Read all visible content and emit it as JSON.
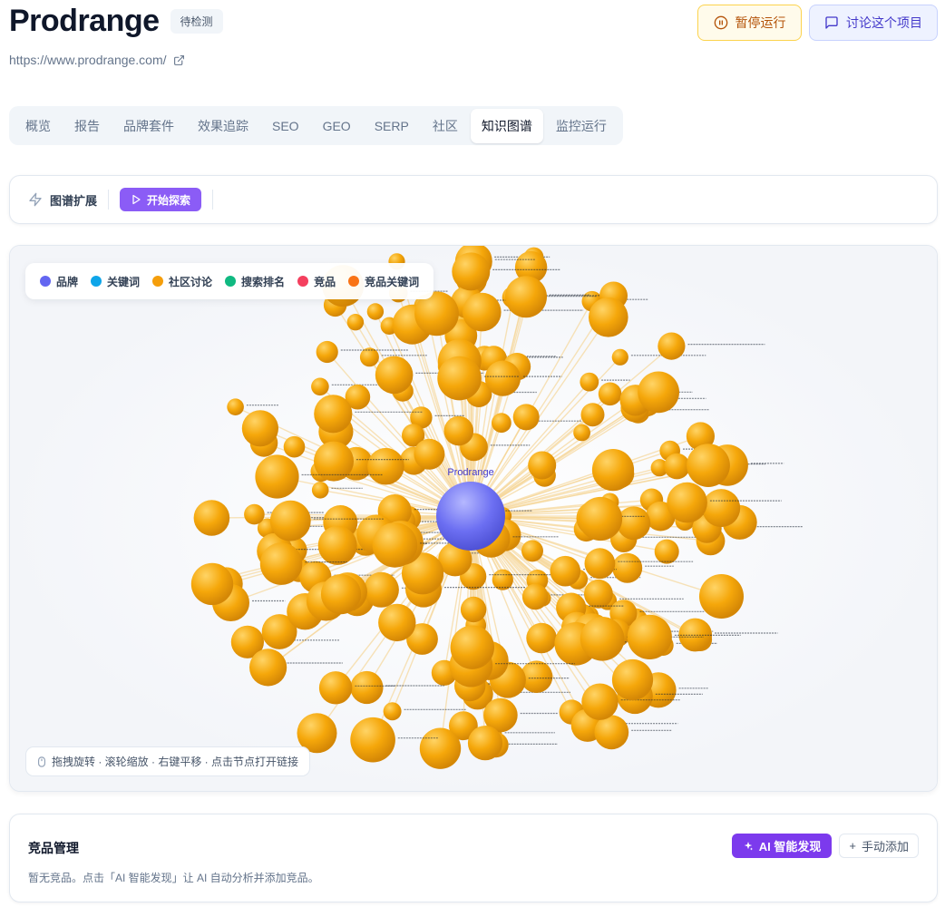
{
  "header": {
    "title": "Prodrange",
    "status": "待检测",
    "url": "https://www.prodrange.com/",
    "pause_label": "暂停运行",
    "discuss_label": "讨论这个项目"
  },
  "tabs": [
    {
      "label": "概览",
      "active": false
    },
    {
      "label": "报告",
      "active": false
    },
    {
      "label": "品牌套件",
      "active": false
    },
    {
      "label": "效果追踪",
      "active": false
    },
    {
      "label": "SEO",
      "active": false
    },
    {
      "label": "GEO",
      "active": false
    },
    {
      "label": "SERP",
      "active": false
    },
    {
      "label": "社区",
      "active": false
    },
    {
      "label": "知识图谱",
      "active": true
    },
    {
      "label": "监控运行",
      "active": false
    }
  ],
  "expand": {
    "label": "图谱扩展",
    "explore_label": "开始探索"
  },
  "graph": {
    "legend": [
      {
        "label": "品牌",
        "color": "#6366f1"
      },
      {
        "label": "关键词",
        "color": "#0ea5e9"
      },
      {
        "label": "社区讨论",
        "color": "#f59e0b"
      },
      {
        "label": "搜索排名",
        "color": "#10b981"
      },
      {
        "label": "竞品",
        "color": "#f43f5e"
      },
      {
        "label": "竞品关键词",
        "color": "#f97316"
      }
    ],
    "center_label": "Prodrange",
    "node_color": "#f59e0b",
    "center_color": "#6366f1",
    "hint": "拖拽旋转 · 滚轮缩放 · 右键平移 · 点击节点打开链接"
  },
  "competitors": {
    "title": "竞品管理",
    "ai_label": "AI 智能发现",
    "manual_label": "手动添加",
    "empty_text": "暂无竞品。点击「AI 智能发现」让 AI 自动分析并添加竞品。"
  }
}
